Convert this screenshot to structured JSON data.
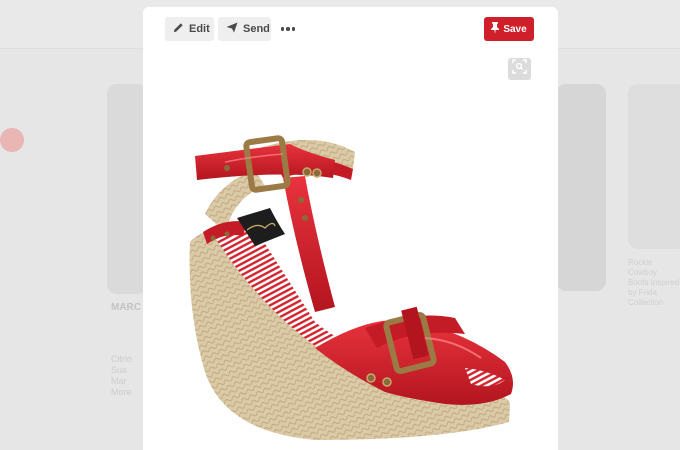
{
  "background": {
    "fab_label": "",
    "left_pin": {
      "title": "MARC\nJa..\nCitrio\nSand",
      "description": "Citrio\nSua\nMar\nMore"
    },
    "right_pin": {
      "description": "Rockie Cowboy\nBoots Inspired\nby Frida\nCollection"
    }
  },
  "toolbar": {
    "edit_label": "Edit",
    "send_label": "Send",
    "save_label": "Save"
  },
  "colors": {
    "save": "#cf1f2a",
    "shoe_red": "#d3232e",
    "jute": "#d9c7a4",
    "backdrop": "#e4e4e4"
  },
  "icons": {
    "edit": "pencil-icon",
    "send": "paper-plane-icon",
    "more": "ellipsis-icon",
    "save": "pushpin-icon",
    "lens": "visual-search-icon"
  }
}
